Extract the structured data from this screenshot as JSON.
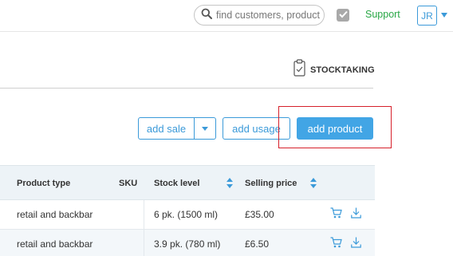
{
  "header": {
    "search_placeholder": "find customers, products",
    "support_label": "Support",
    "user_initials": "JR"
  },
  "stocktaking": {
    "label": "STOCKTAKING"
  },
  "actions": {
    "add_sale": "add sale",
    "add_usage": "add usage",
    "add_product": "add product"
  },
  "table": {
    "columns": [
      "Product type",
      "SKU",
      "Stock level",
      "Selling price"
    ],
    "rows": [
      {
        "product_type": "retail and backbar",
        "sku": "",
        "stock_level": "6 pk. (1500 ml)",
        "selling_price": "£35.00"
      },
      {
        "product_type": "retail and backbar",
        "sku": "",
        "stock_level": "3.9 pk. (780 ml)",
        "selling_price": "£6.50"
      }
    ]
  },
  "colors": {
    "accent": "#3b9ad9",
    "primary_button": "#42a5e5",
    "support_green": "#28a745",
    "highlight_red": "#d6202b"
  }
}
